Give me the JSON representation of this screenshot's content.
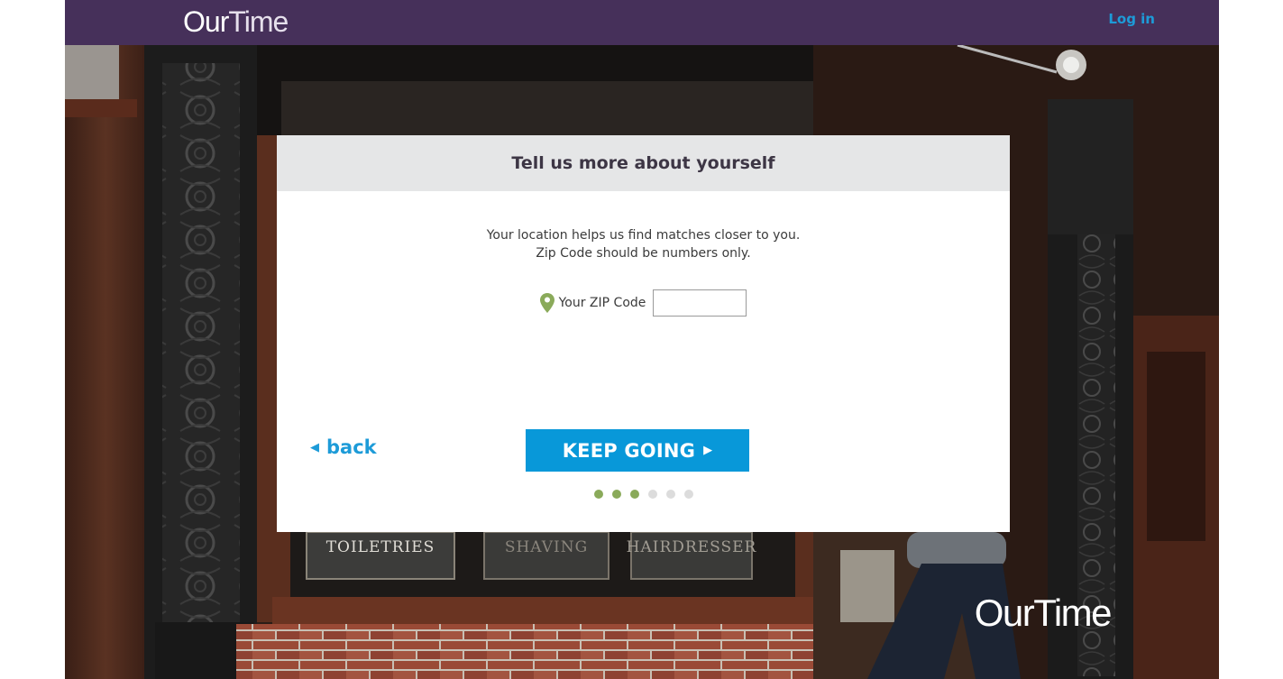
{
  "header": {
    "logo_part1": "Our",
    "logo_part2": "Time",
    "login_label": "Log in"
  },
  "modal": {
    "title": "Tell us more about yourself",
    "intro_line1": "Your location helps us find matches closer to you.",
    "intro_line2": "Zip Code should be numbers only.",
    "zip_label": "Your ZIP Code",
    "zip_value": "",
    "back_label": "back",
    "keep_going_label": "KEEP GOING",
    "progress": {
      "total_steps": 6,
      "completed_steps": 3
    }
  },
  "background": {
    "signs": [
      "TOILETRIES",
      "SHAVING",
      "HAIRDRESSER"
    ],
    "watermark_part1": "Our",
    "watermark_part2": "Time"
  },
  "colors": {
    "header": "#46305a",
    "accent": "#0898d9",
    "link": "#1d9bd8",
    "progress_done": "#8aaa5a",
    "progress_todo": "#dcdcdc",
    "pin": "#8aaa5a"
  },
  "icons": {
    "location": "location-pin-icon",
    "back": "triangle-left-icon",
    "forward": "triangle-right-icon"
  }
}
